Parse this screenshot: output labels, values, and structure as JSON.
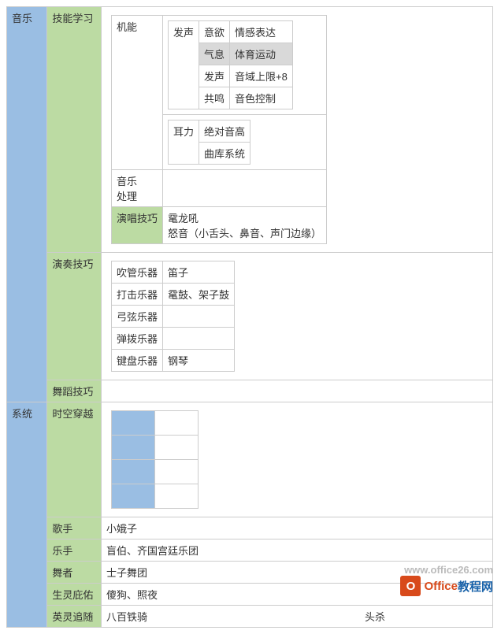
{
  "sections": {
    "music": {
      "label": "音乐",
      "skillLearning": {
        "label": "技能学习",
        "function": {
          "label": "机能",
          "vocalization": {
            "label": "发声",
            "rows": [
              {
                "k": "意欲",
                "v": "情感表达"
              },
              {
                "k": "气息",
                "v": "体育运动"
              },
              {
                "k": "发声",
                "v": "音域上限+8"
              },
              {
                "k": "共鸣",
                "v": "音色控制"
              }
            ]
          },
          "ear": {
            "label": "耳力",
            "v1": "绝对音高",
            "v2": "曲库系统"
          }
        },
        "musicHandling": {
          "label1": "音乐",
          "label2": "处理"
        },
        "singingSkill": {
          "label": "演唱技巧",
          "line1": "鼋龙吼",
          "line2": "怒音（小舌头、鼻音、声门边缘）"
        }
      },
      "performSkill": {
        "label": "演奏技巧",
        "rows": [
          {
            "k": "吹管乐器",
            "v": "笛子"
          },
          {
            "k": "打击乐器",
            "v": "鼋鼓、架子鼓"
          },
          {
            "k": "弓弦乐器",
            "v": ""
          },
          {
            "k": "弹拨乐器",
            "v": ""
          },
          {
            "k": "键盘乐器",
            "v": "钢琴"
          }
        ]
      },
      "danceSkill": {
        "label": "舞蹈技巧"
      }
    },
    "system": {
      "label": "系统",
      "timeTravel": {
        "label": "时空穿越"
      },
      "singer": {
        "label": "歌手",
        "value": "小娥子"
      },
      "musician": {
        "label": "乐手",
        "value": "盲伯、齐国宫廷乐团"
      },
      "dancer": {
        "label": "舞者",
        "value": "士子舞团"
      },
      "guardian": {
        "label": "生灵庇佑",
        "value": "傻狗、照夜"
      },
      "spirit": {
        "label": "英灵追随",
        "value": "八百铁骑",
        "tail": "头杀"
      }
    }
  },
  "watermark": {
    "faded": "www.office26.com",
    "logo": "O",
    "t1": "Office",
    "t2": "教程网"
  }
}
